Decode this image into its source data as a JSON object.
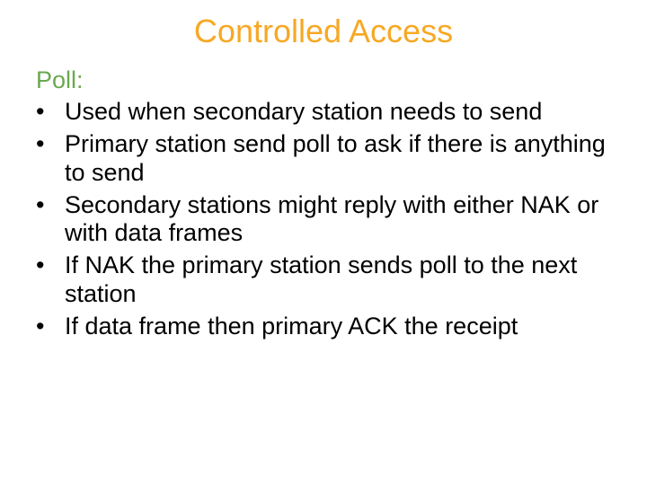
{
  "colors": {
    "title": "#f7a823",
    "subheading": "#6aa84f",
    "body": "#000000"
  },
  "title": "Controlled Access",
  "subheading": "Poll:",
  "bullets": [
    "Used when secondary station needs to send",
    "Primary station send poll to ask if there is anything to send",
    "Secondary stations might reply with either NAK or with data frames",
    "If NAK the primary station sends poll to the next station",
    "If data frame then primary ACK the receipt"
  ]
}
